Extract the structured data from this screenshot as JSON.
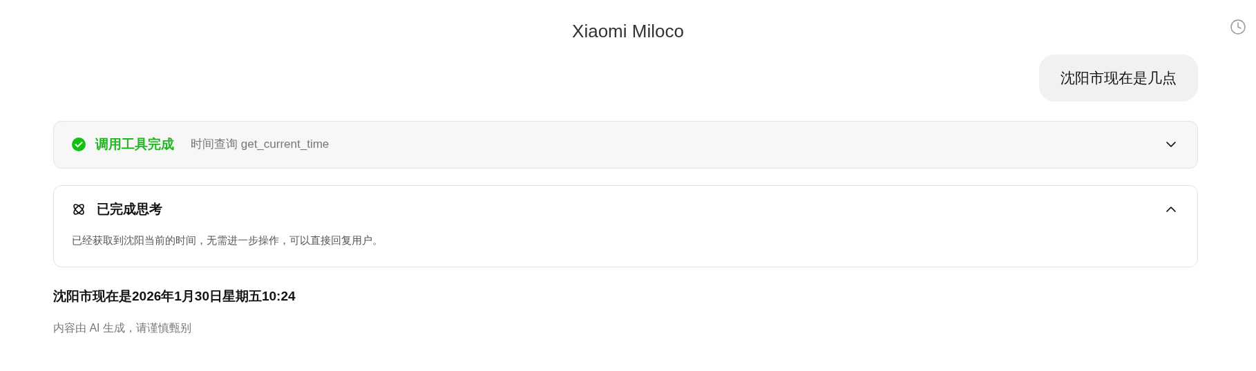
{
  "header": {
    "title": "Xiaomi Miloco"
  },
  "user_message": "沈阳市现在是几点",
  "tool_call": {
    "done": true,
    "status_text": "调用工具完成",
    "detail": "时间查询 get_current_time",
    "expanded": false
  },
  "thinking": {
    "title": "已完成思考",
    "text": "已经获取到沈阳当前的时间，无需进一步操作，可以直接回复用户。",
    "expanded": true
  },
  "answer": "沈阳市现在是2026年1月30日星期五10:24",
  "disclaimer": "内容由 AI 生成，请谨慎甄别"
}
